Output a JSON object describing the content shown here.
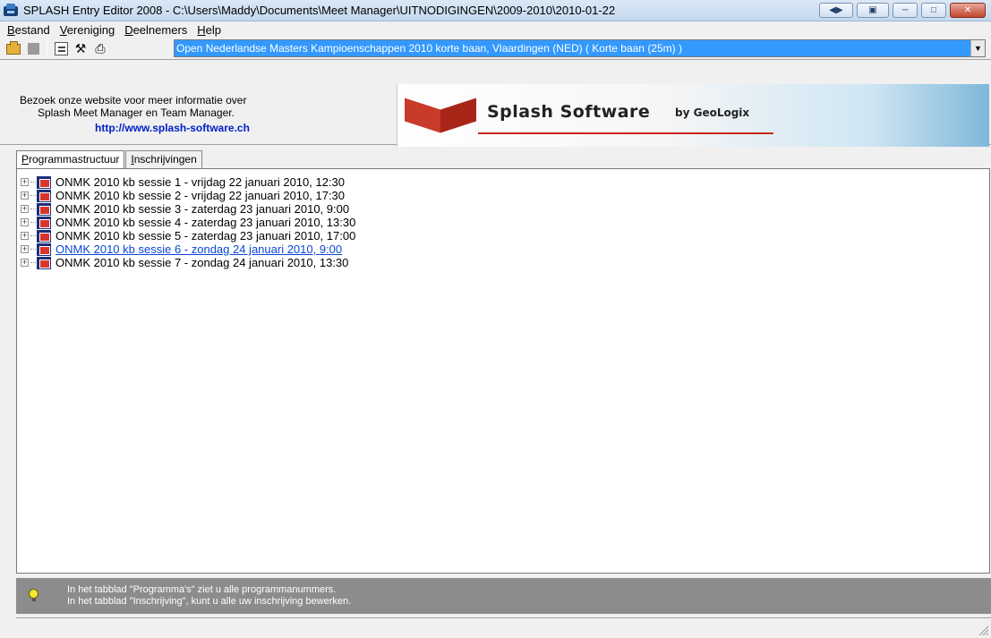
{
  "window": {
    "title": "SPLASH Entry Editor 2008 - C:\\Users\\Maddy\\Documents\\Meet Manager\\UITNODIGINGEN\\2009-2010\\2010-01-22"
  },
  "menu": {
    "items": [
      {
        "underline": "B",
        "rest": "estand"
      },
      {
        "underline": "V",
        "rest": "ereniging"
      },
      {
        "underline": "D",
        "rest": "eelnemers"
      },
      {
        "underline": "H",
        "rest": "elp"
      }
    ]
  },
  "toolbar": {
    "meet_selected": "Open Nederlandse Masters Kampioenschappen 2010 korte baan,  Vlaardingen  (NED)   ( Korte baan (25m) )"
  },
  "banner": {
    "line1": "Bezoek onze website voor meer informatie over",
    "line2": "Splash Meet Manager en Team Manager.",
    "link": "http://www.splash-software.ch",
    "logo_name": "Splash Software",
    "logo_by": "by GeoLogix"
  },
  "tabs": [
    {
      "underline": "P",
      "rest": "rogrammastructuur",
      "active": true
    },
    {
      "underline": "I",
      "rest": "nschrijvingen",
      "active": false
    }
  ],
  "sessions": [
    "ONMK 2010 kb sessie 1 - vrijdag 22 januari 2010, 12:30",
    "ONMK 2010 kb sessie 2 - vrijdag 22 januari 2010, 17:30",
    "ONMK 2010 kb sessie 3 - zaterdag 23 januari 2010, 9:00",
    "ONMK 2010 kb sessie 4 - zaterdag 23 januari 2010, 13:30",
    "ONMK 2010 kb sessie 5 - zaterdag 23 januari 2010, 17:00",
    "ONMK 2010 kb sessie 6 - zondag 24 januari 2010, 9:00",
    "ONMK 2010 kb sessie 7 - zondag 24 januari 2010, 13:30"
  ],
  "selected_session_index": 5,
  "hint": {
    "line1": "In het tabblad \"Programma's\" ziet u alle programmanummers.",
    "line2": "In het tabblad \"Inschrijving\", kunt u alle uw inschrijving bewerken."
  },
  "icons": {
    "app": "splash-app-icon",
    "open": "open-folder-icon",
    "properties": "properties-icon",
    "tools": "wrench-icon",
    "print": "printer-icon",
    "hint": "lightbulb-icon"
  }
}
